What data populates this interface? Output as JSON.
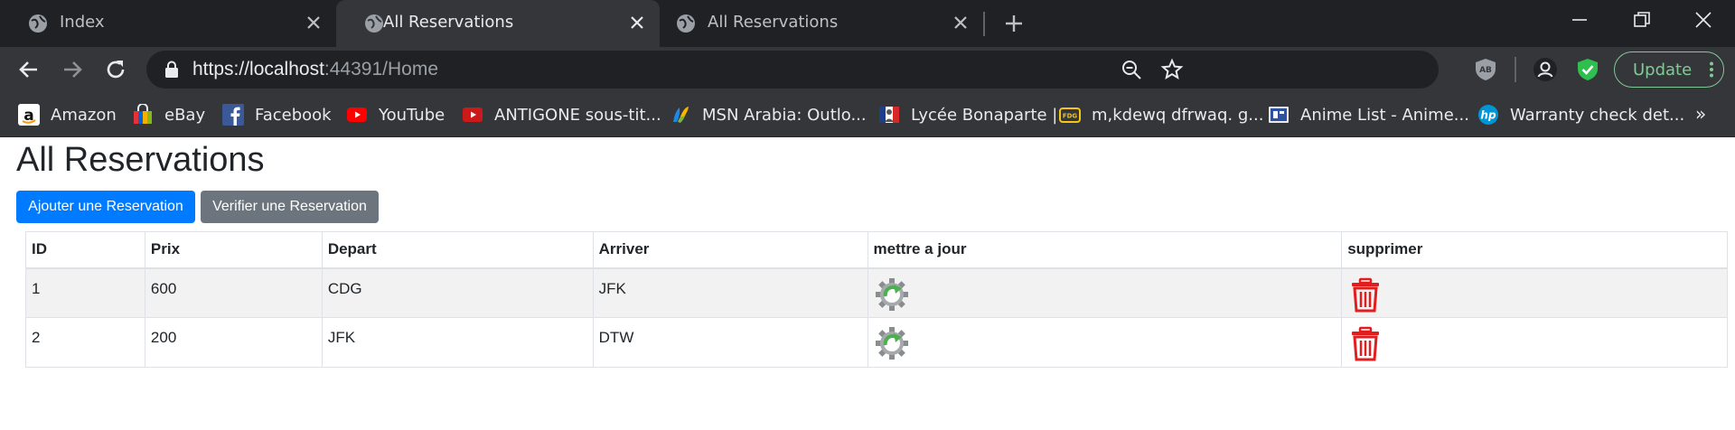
{
  "tabs": [
    {
      "title": "Index",
      "active": false
    },
    {
      "title": "All Reservations",
      "active": true
    },
    {
      "title": "All Reservations",
      "active": false
    }
  ],
  "address_bar": {
    "scheme": "https://",
    "host": "localhost",
    "rest": ":44391/Home"
  },
  "update_label": "Update",
  "bookmarks": [
    {
      "label": "Amazon",
      "icon": "amazon-icon"
    },
    {
      "label": "eBay",
      "icon": "ebay-icon"
    },
    {
      "label": "Facebook",
      "icon": "facebook-icon"
    },
    {
      "label": "YouTube",
      "icon": "youtube-icon"
    },
    {
      "label": "ANTIGONE sous-tit...",
      "icon": "youtube-icon"
    },
    {
      "label": "MSN Arabia: Outlo...",
      "icon": "msn-icon"
    },
    {
      "label": "Lycée Bonaparte |",
      "icon": "lycee-icon"
    },
    {
      "label": "m,kdewq dfrwaq. g...",
      "icon": "fdg-icon"
    },
    {
      "label": "Anime List - Anime...",
      "icon": "anime-list-icon"
    },
    {
      "label": "Warranty check det...",
      "icon": "hp-icon"
    }
  ],
  "bookmarks_overflow": "»",
  "page": {
    "title": "All Reservations",
    "add_button": "Ajouter une Reservation",
    "verify_button": "Verifier une Reservation"
  },
  "table": {
    "headers": [
      "ID",
      "Prix",
      "Depart",
      "Arriver",
      "mettre a jour",
      "supprimer"
    ],
    "rows": [
      {
        "id": "1",
        "prix": "600",
        "depart": "CDG",
        "arriver": "JFK"
      },
      {
        "id": "2",
        "prix": "200",
        "depart": "JFK",
        "arriver": "DTW"
      }
    ]
  },
  "colors": {
    "primary": "#007bff",
    "secondary": "#6c757d",
    "update_green": "#81c995",
    "delete_red": "#e11d1d"
  }
}
